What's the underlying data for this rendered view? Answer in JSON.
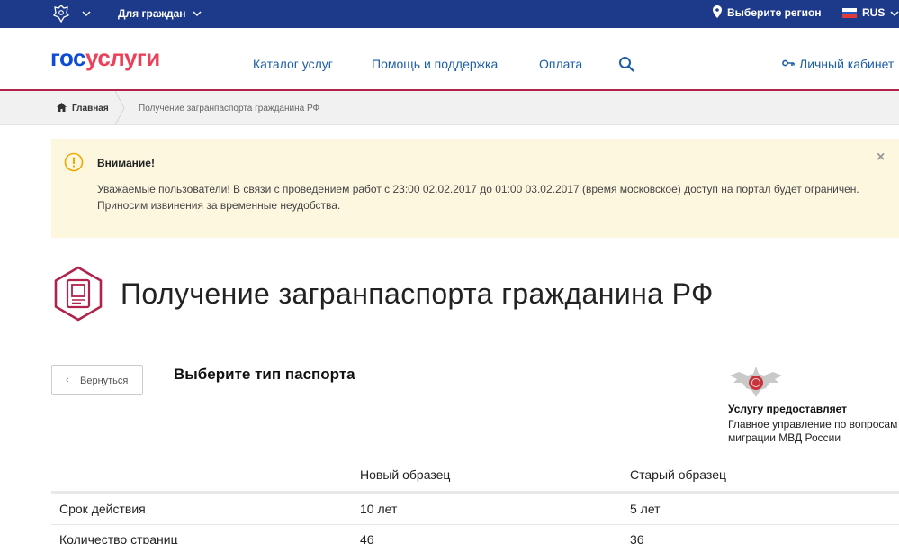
{
  "topbar": {
    "citizens_label": "Для граждан",
    "region_label": "Выберите регион",
    "language": "RUS",
    "background_color": "#1d3a8a"
  },
  "header": {
    "logo_part1": "гос",
    "logo_part2": "услуги",
    "nav": [
      {
        "label": "Каталог услуг"
      },
      {
        "label": "Помощь и поддержка"
      },
      {
        "label": "Оплата"
      }
    ],
    "cabinet_label": "Личный кабинет",
    "icons": [
      "search-icon",
      "key-icon"
    ]
  },
  "breadcrumb": {
    "home": "Главная",
    "current": "Получение загранпаспорта гражданина РФ"
  },
  "alert": {
    "title": "Внимание!",
    "text": "Уважаемые пользователи! В связи с проведением работ с 23:00 02.02.2017 до 01:00 03.02.2017 (время московское) доступ на портал будет ограничен. Приносим извинения за временные неудобства.",
    "close": "×",
    "icon": "warning-icon"
  },
  "service": {
    "title": "Получение загранпаспорта гражданина РФ",
    "icon": "passport-icon"
  },
  "main": {
    "back_label": "Вернуться",
    "choose_label": "Выберите тип паспорта"
  },
  "provider": {
    "label": "Услугу предоставляет",
    "name": "Главное управление по вопросам миграции МВД России",
    "icon": "mvd-emblem-icon"
  },
  "table": {
    "headers": [
      "",
      "Новый образец",
      "Старый образец"
    ],
    "rows": [
      [
        "Срок действия",
        "10 лет",
        "5 лет"
      ],
      [
        "Количество страниц",
        "46",
        "36"
      ]
    ]
  },
  "colors": {
    "brand_blue": "#0d4cd3",
    "brand_red": "#ee3f58",
    "accent_crimson": "#b0234a",
    "link_blue": "#1d5ea8",
    "alert_bg": "#fdf7e0",
    "alert_icon": "#f0a800"
  }
}
